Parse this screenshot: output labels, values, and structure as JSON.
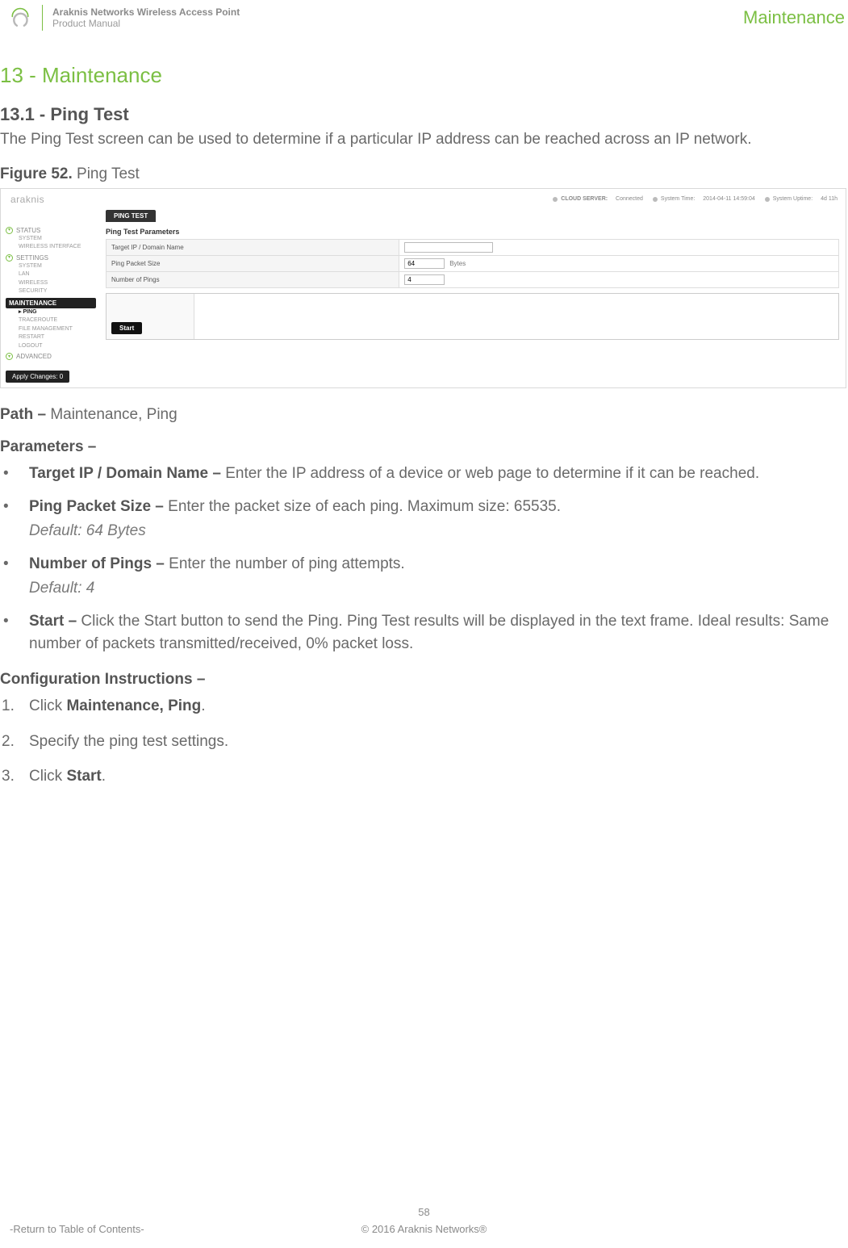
{
  "header": {
    "product_line1": "Araknis Networks Wireless Access Point",
    "product_line2": "Product Manual",
    "section_label": "Maintenance"
  },
  "titles": {
    "h1": "13 - Maintenance",
    "h2": "13.1 - Ping Test"
  },
  "intro": "The Ping Test screen can be used to determine if a particular IP address can be reached across an IP network.",
  "figure": {
    "label": "Figure 52.",
    "name": "Ping Test"
  },
  "screenshot": {
    "brand": "araknis",
    "tab": "PING TEST",
    "topbar": {
      "cloud": {
        "label": "CLOUD SERVER:",
        "value": "Connected"
      },
      "time": {
        "label": "System Time:",
        "value": "2014-04-11 14:59:04"
      },
      "uptime": {
        "label": "System Uptime:",
        "value": "4d 11h"
      }
    },
    "nav": {
      "status": {
        "label": "STATUS",
        "items": [
          "SYSTEM",
          "WIRELESS INTERFACE"
        ]
      },
      "settings": {
        "label": "SETTINGS",
        "items": [
          "SYSTEM",
          "LAN",
          "WIRELESS",
          "SECURITY"
        ]
      },
      "maint": {
        "label": "MAINTENANCE",
        "items": [
          "PING",
          "TRACEROUTE",
          "FILE MANAGEMENT",
          "RESTART",
          "LOGOUT"
        ]
      },
      "advanced": {
        "label": "ADVANCED"
      }
    },
    "apply": "Apply Changes: 0",
    "panel": {
      "title": "Ping Test Parameters",
      "rows": {
        "target": {
          "label": "Target IP / Domain Name",
          "value": ""
        },
        "size": {
          "label": "Ping Packet Size",
          "value": "64",
          "unit": "Bytes"
        },
        "count": {
          "label": "Number of Pings",
          "value": "4"
        }
      },
      "start": "Start"
    }
  },
  "path": {
    "lead": "Path –",
    "value": "Maintenance, Ping"
  },
  "parameters": {
    "heading": "Parameters –",
    "items": [
      {
        "name": "Target IP / Domain Name –",
        "desc": "Enter the IP address of a device or web page to determine if it can be reached."
      },
      {
        "name": "Ping Packet Size –",
        "desc": "Enter the packet size of each ping. Maximum size: 65535.",
        "default": "Default: 64 Bytes"
      },
      {
        "name": "Number of Pings –",
        "desc": "Enter the number of ping attempts.",
        "default": "Default: 4"
      },
      {
        "name": "Start –",
        "desc": "Click the Start button to send the Ping. Ping Test results will be displayed in the text frame. Ideal results: Same number of packets transmitted/received, 0% packet loss."
      }
    ]
  },
  "config": {
    "heading": "Configuration Instructions –",
    "steps": [
      {
        "pre": "Click ",
        "strong": "Maintenance, Ping",
        "post": "."
      },
      {
        "pre": "Specify the ping test settings.",
        "strong": "",
        "post": ""
      },
      {
        "pre": "Click ",
        "strong": "Start",
        "post": "."
      }
    ]
  },
  "footer": {
    "page": "58",
    "toc": "-Return to Table of Contents-",
    "copyright": "© 2016 Araknis Networks®"
  }
}
